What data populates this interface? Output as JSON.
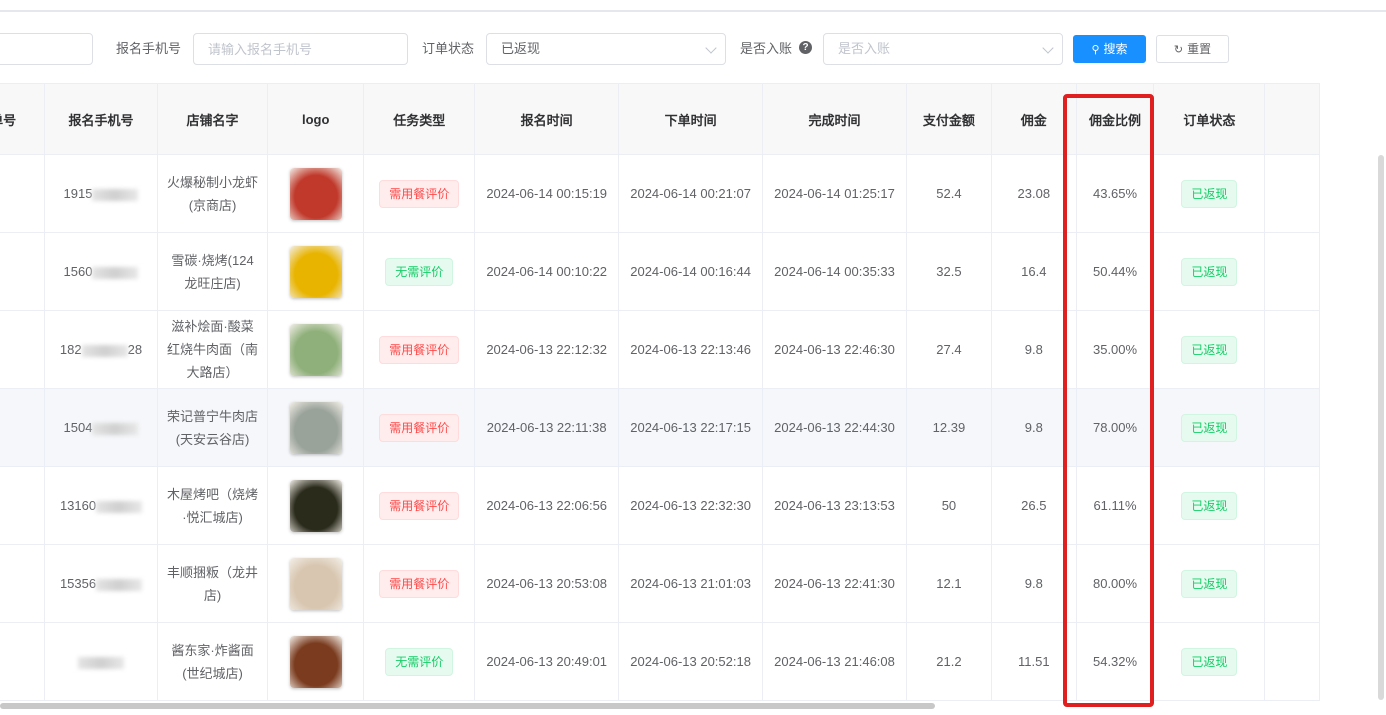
{
  "filters": {
    "phone_label": "报名手机号",
    "phone_placeholder": "请输入报名手机号",
    "status_label": "订单状态",
    "status_value": "已返现",
    "account_label": "是否入账",
    "account_help_icon": "question-circle-icon",
    "account_placeholder": "是否入账",
    "search_button": "搜索",
    "search_icon": "search-icon",
    "reset_button": "重置",
    "reset_icon": "refresh-icon"
  },
  "table": {
    "columns": [
      "单号",
      "报名手机号",
      "店铺名字",
      "logo",
      "任务类型",
      "报名时间",
      "下单时间",
      "完成时间",
      "支付金额",
      "佣金",
      "佣金比例",
      "订单状态"
    ],
    "rows": [
      {
        "phone": "1915",
        "phone_tail": "",
        "shop_line1": "火爆秘制小龙虾",
        "shop_line2": "(京商店)",
        "shop_line3": "",
        "task": "需用餐评价",
        "task_type": "red",
        "signup": "2024-06-14 00:15:19",
        "order": "2024-06-14 00:21:07",
        "complete": "2024-06-14 01:25:17",
        "pay": "52.4",
        "commission": "23.08",
        "ratio": "43.65%",
        "status": "已返现",
        "logo_color": "#c0392b"
      },
      {
        "phone": "1560",
        "phone_tail": "",
        "shop_line1": "雪碳·烧烤(124",
        "shop_line2": "龙旺庄店)",
        "shop_line3": "",
        "task": "无需评价",
        "task_type": "green",
        "signup": "2024-06-14 00:10:22",
        "order": "2024-06-14 00:16:44",
        "complete": "2024-06-14 00:35:33",
        "pay": "32.5",
        "commission": "16.4",
        "ratio": "50.44%",
        "status": "已返现",
        "logo_color": "#e8b400"
      },
      {
        "phone": "182",
        "phone_tail": "28",
        "shop_line1": "滋补烩面·酸菜",
        "shop_line2": "红烧牛肉面（南",
        "shop_line3": "大路店）",
        "task": "需用餐评价",
        "task_type": "red",
        "signup": "2024-06-13 22:12:32",
        "order": "2024-06-13 22:13:46",
        "complete": "2024-06-13 22:46:30",
        "pay": "27.4",
        "commission": "9.8",
        "ratio": "35.00%",
        "status": "已返现",
        "logo_color": "#8fb07a"
      },
      {
        "phone": "1504",
        "phone_tail": "",
        "shop_line1": "荣记普宁牛肉店",
        "shop_line2": "(天安云谷店)",
        "shop_line3": "",
        "task": "需用餐评价",
        "task_type": "red",
        "signup": "2024-06-13 22:11:38",
        "order": "2024-06-13 22:17:15",
        "complete": "2024-06-13 22:44:30",
        "pay": "12.39",
        "commission": "9.8",
        "ratio": "78.00%",
        "status": "已返现",
        "logo_color": "#9aa39a"
      },
      {
        "phone": "13160",
        "phone_tail": "",
        "shop_line1": "木屋烤吧（烧烤",
        "shop_line2": "·悦汇城店)",
        "shop_line3": "",
        "task": "需用餐评价",
        "task_type": "red",
        "signup": "2024-06-13 22:06:56",
        "order": "2024-06-13 22:32:30",
        "complete": "2024-06-13 23:13:53",
        "pay": "50",
        "commission": "26.5",
        "ratio": "61.11%",
        "status": "已返现",
        "logo_color": "#2b2b1c"
      },
      {
        "phone": "15356",
        "phone_tail": "",
        "shop_line1": "丰顺捆粄（龙井",
        "shop_line2": "店)",
        "shop_line3": "",
        "task": "需用餐评价",
        "task_type": "red",
        "signup": "2024-06-13 20:53:08",
        "order": "2024-06-13 21:01:03",
        "complete": "2024-06-13 22:41:30",
        "pay": "12.1",
        "commission": "9.8",
        "ratio": "80.00%",
        "status": "已返现",
        "logo_color": "#d8c6b0"
      },
      {
        "phone": "",
        "phone_tail": "",
        "shop_line1": "酱东家·炸酱面",
        "shop_line2": "(世纪城店)",
        "shop_line3": "",
        "task": "无需评价",
        "task_type": "green",
        "signup": "2024-06-13 20:49:01",
        "order": "2024-06-13 20:52:18",
        "complete": "2024-06-13 21:46:08",
        "pay": "21.2",
        "commission": "11.51",
        "ratio": "54.32%",
        "status": "已返现",
        "logo_color": "#7a3b1e"
      }
    ]
  },
  "highlight_color": "#e02020"
}
